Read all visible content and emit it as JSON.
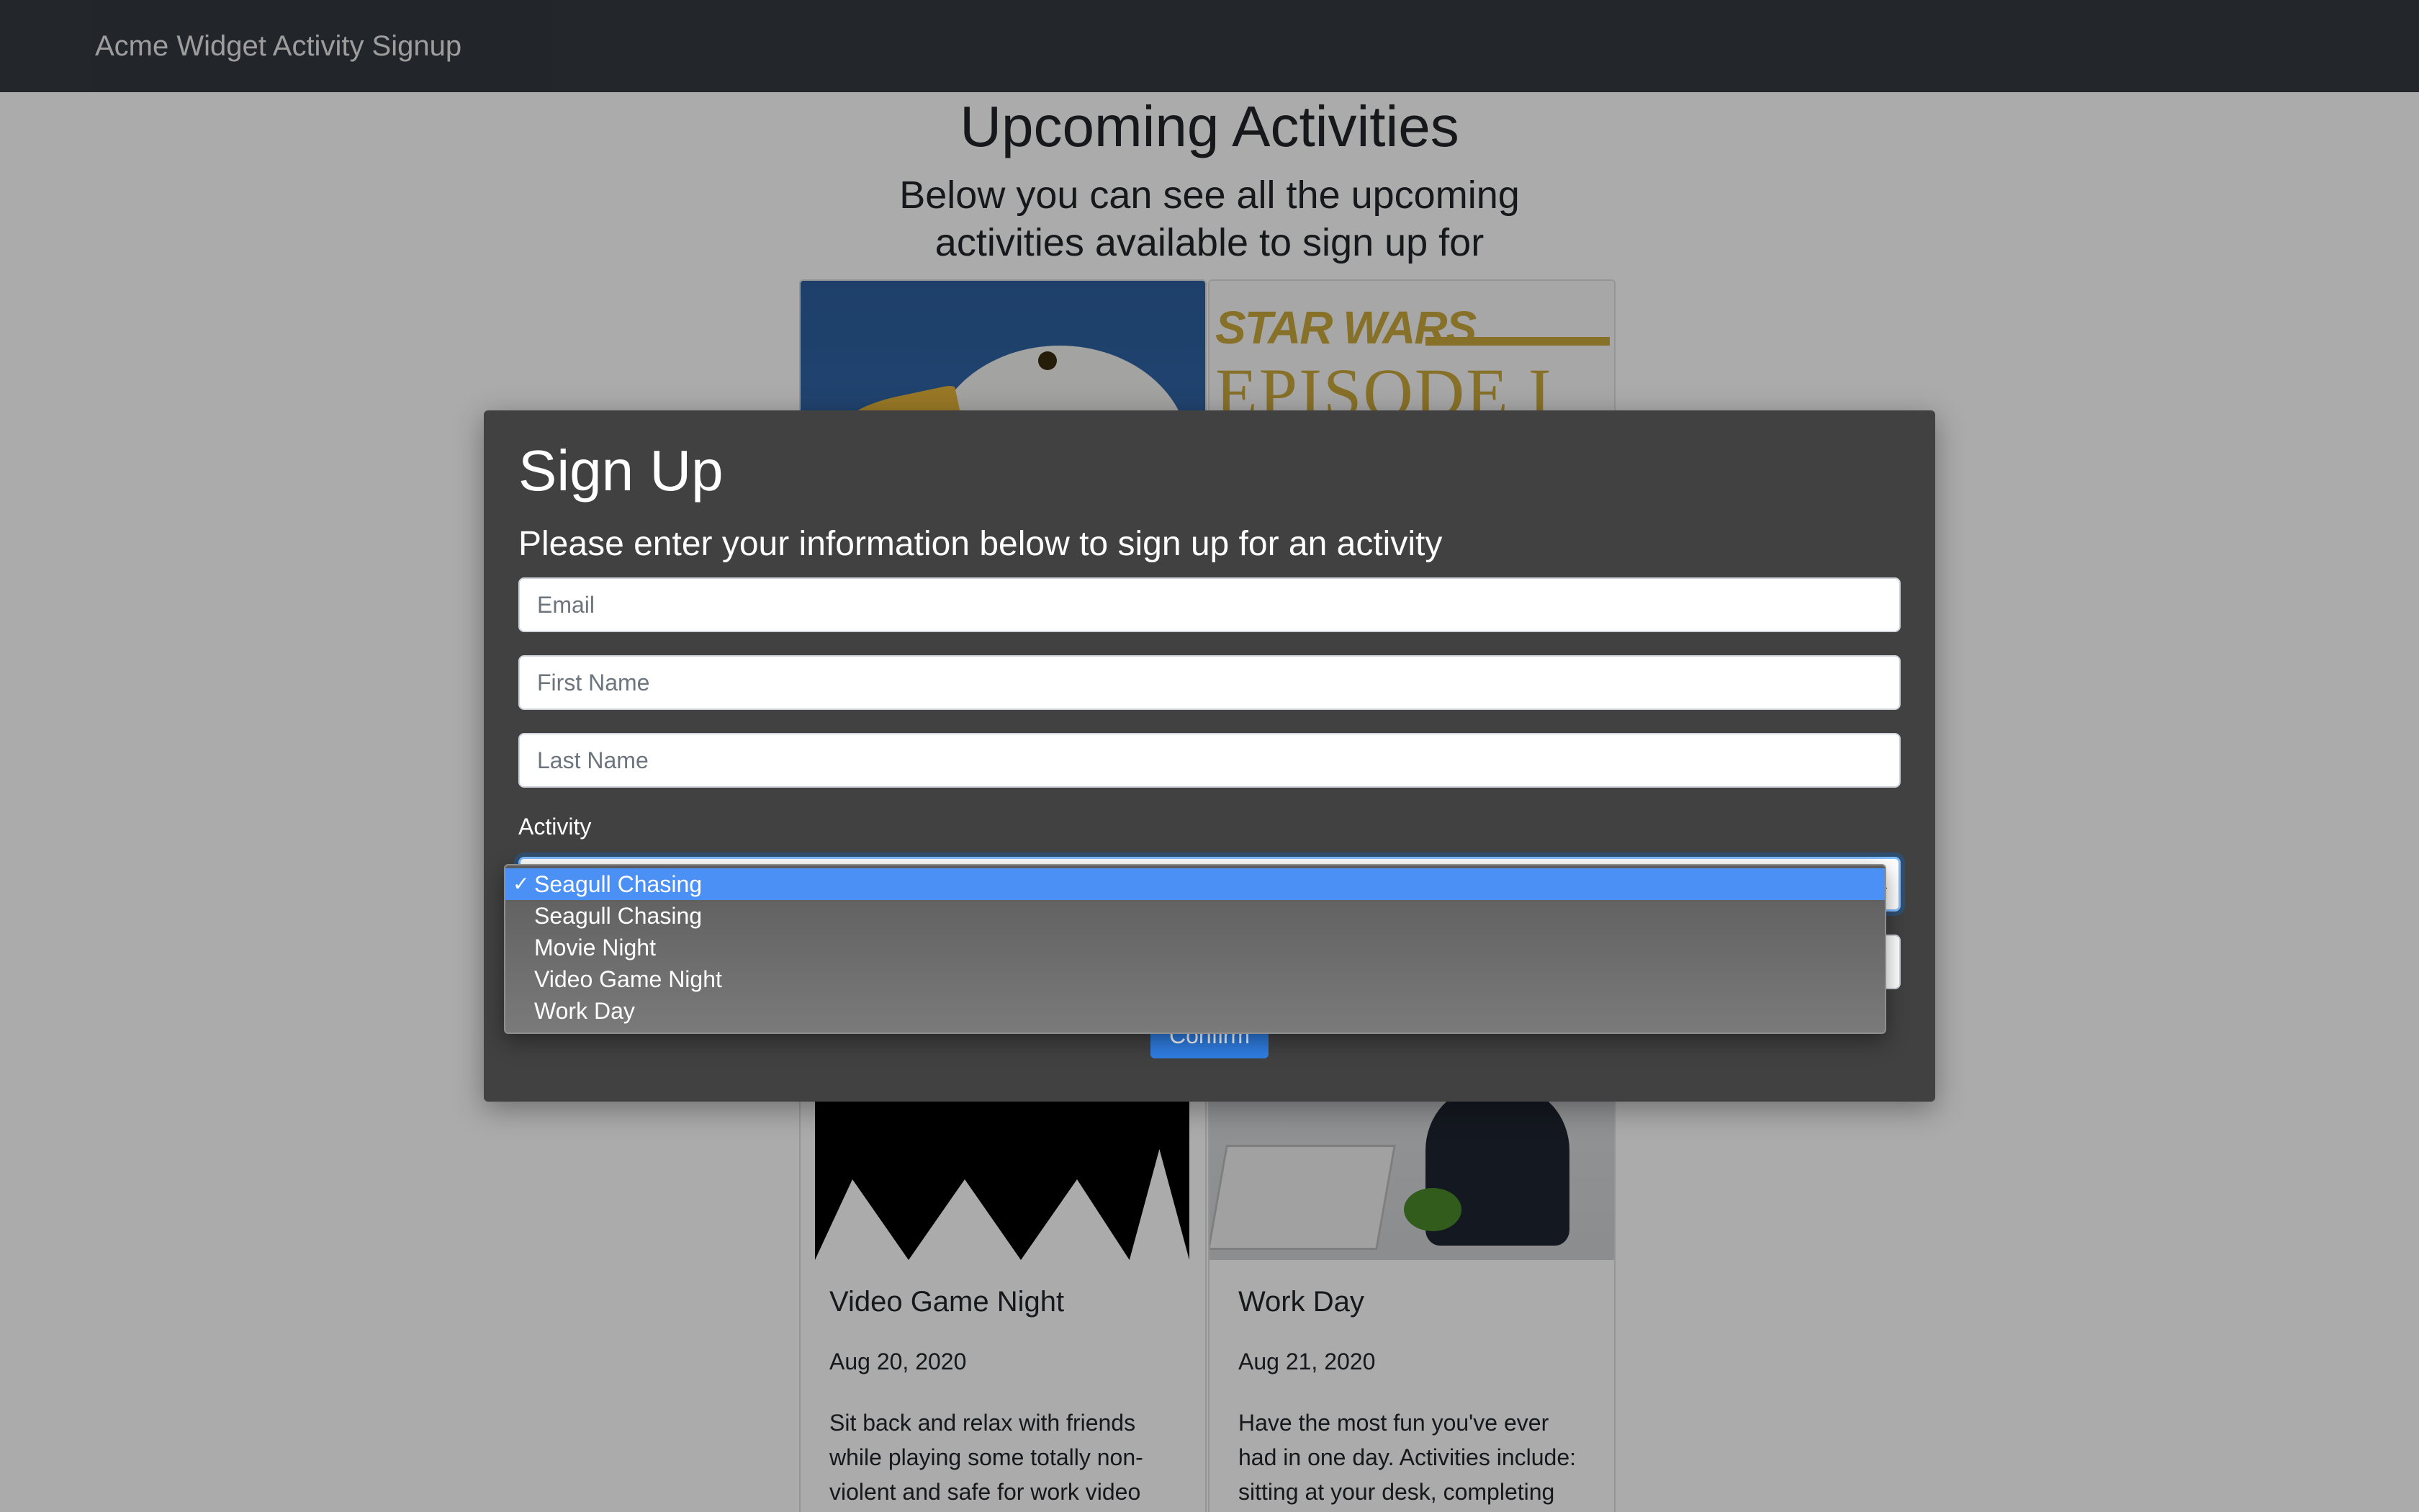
{
  "navbar": {
    "brand": "Acme Widget Activity Signup"
  },
  "main": {
    "title": "Upcoming Activities",
    "subtitle": "Below you can see all the upcoming activities available to sign up for"
  },
  "cards": [
    {
      "title": "Video Game Night",
      "date": "Aug 20, 2020",
      "text": "Sit back and relax with friends while playing some totally non-violent and safe for work video game titles such as Doom, or"
    },
    {
      "title": "Work Day",
      "date": "Aug 21, 2020",
      "text": "Have the most fun you've ever had in one day. Activities include: sitting at your desk, completing tasks, being productive,"
    }
  ],
  "card_images": {
    "star_wars_line1": "STAR WARS",
    "star_wars_line2": "EPISODE I"
  },
  "modal": {
    "title": "Sign Up",
    "subtitle": "Please enter your information below to sign up for an activity",
    "email_placeholder": "Email",
    "first_name_placeholder": "First Name",
    "last_name_placeholder": "Last Name",
    "activity_label": "Activity",
    "confirm_label": "Confirm"
  },
  "dropdown": {
    "check": "✓",
    "options": [
      "Seagull Chasing",
      "Seagull Chasing",
      "Movie Night",
      "Video Game Night",
      "Work Day"
    ],
    "selected_index": 0
  },
  "colors": {
    "navbar_bg": "#343a40",
    "modal_bg": "#414141",
    "accent": "#2f7de1",
    "selected_option": "#4a90f5"
  }
}
